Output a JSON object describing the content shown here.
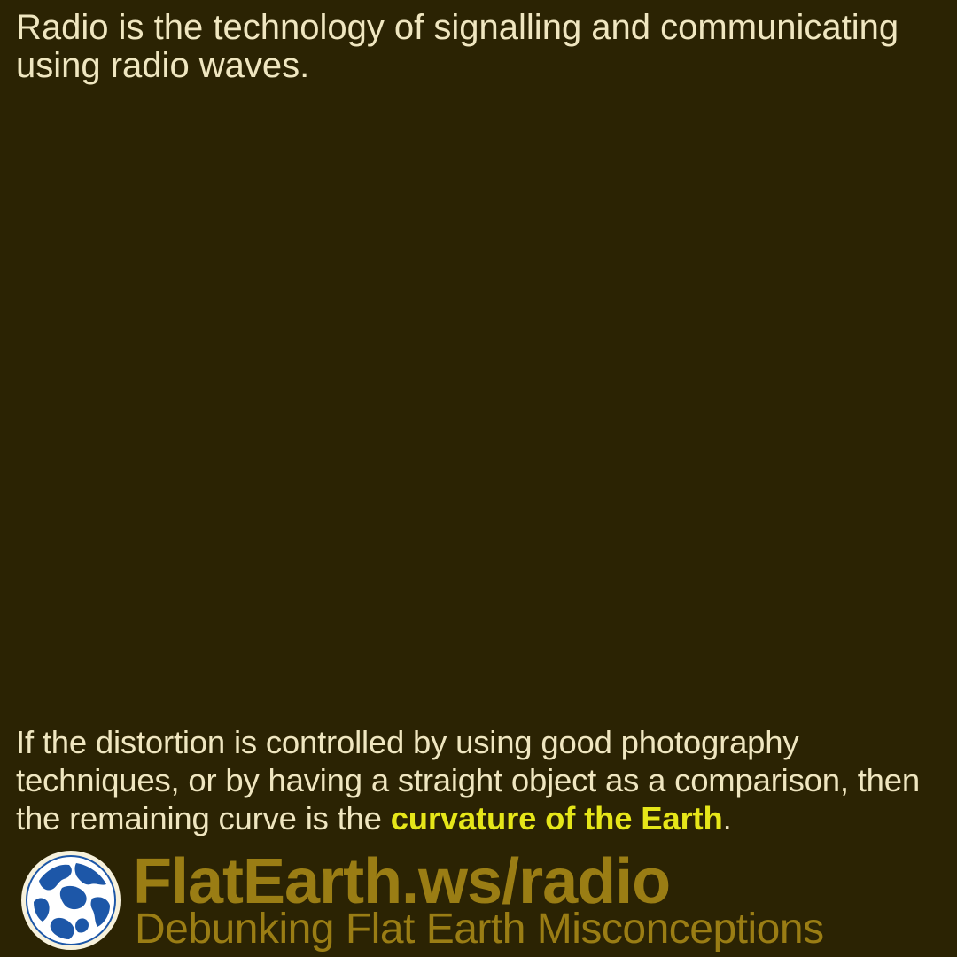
{
  "intro": {
    "text": "Radio is the technology of signalling and communicating using radio waves."
  },
  "detail": {
    "text_before": "If the distortion is controlled by using good photography techniques, or by having a straight object as a comparison, then the remaining curve is the ",
    "highlight": "curvature of the Earth",
    "text_after": "."
  },
  "footer": {
    "site": "FlatEarth.ws/radio",
    "tagline": "Debunking Flat Earth Misconceptions",
    "logo_icon": "globe-icon"
  },
  "colors": {
    "background": "#2b2303",
    "body_text": "#efe6c0",
    "highlight": "#e6e619",
    "brand": "#9a7d14",
    "globe_land": "#1d57a8",
    "globe_sea": "#f7f1dc"
  }
}
